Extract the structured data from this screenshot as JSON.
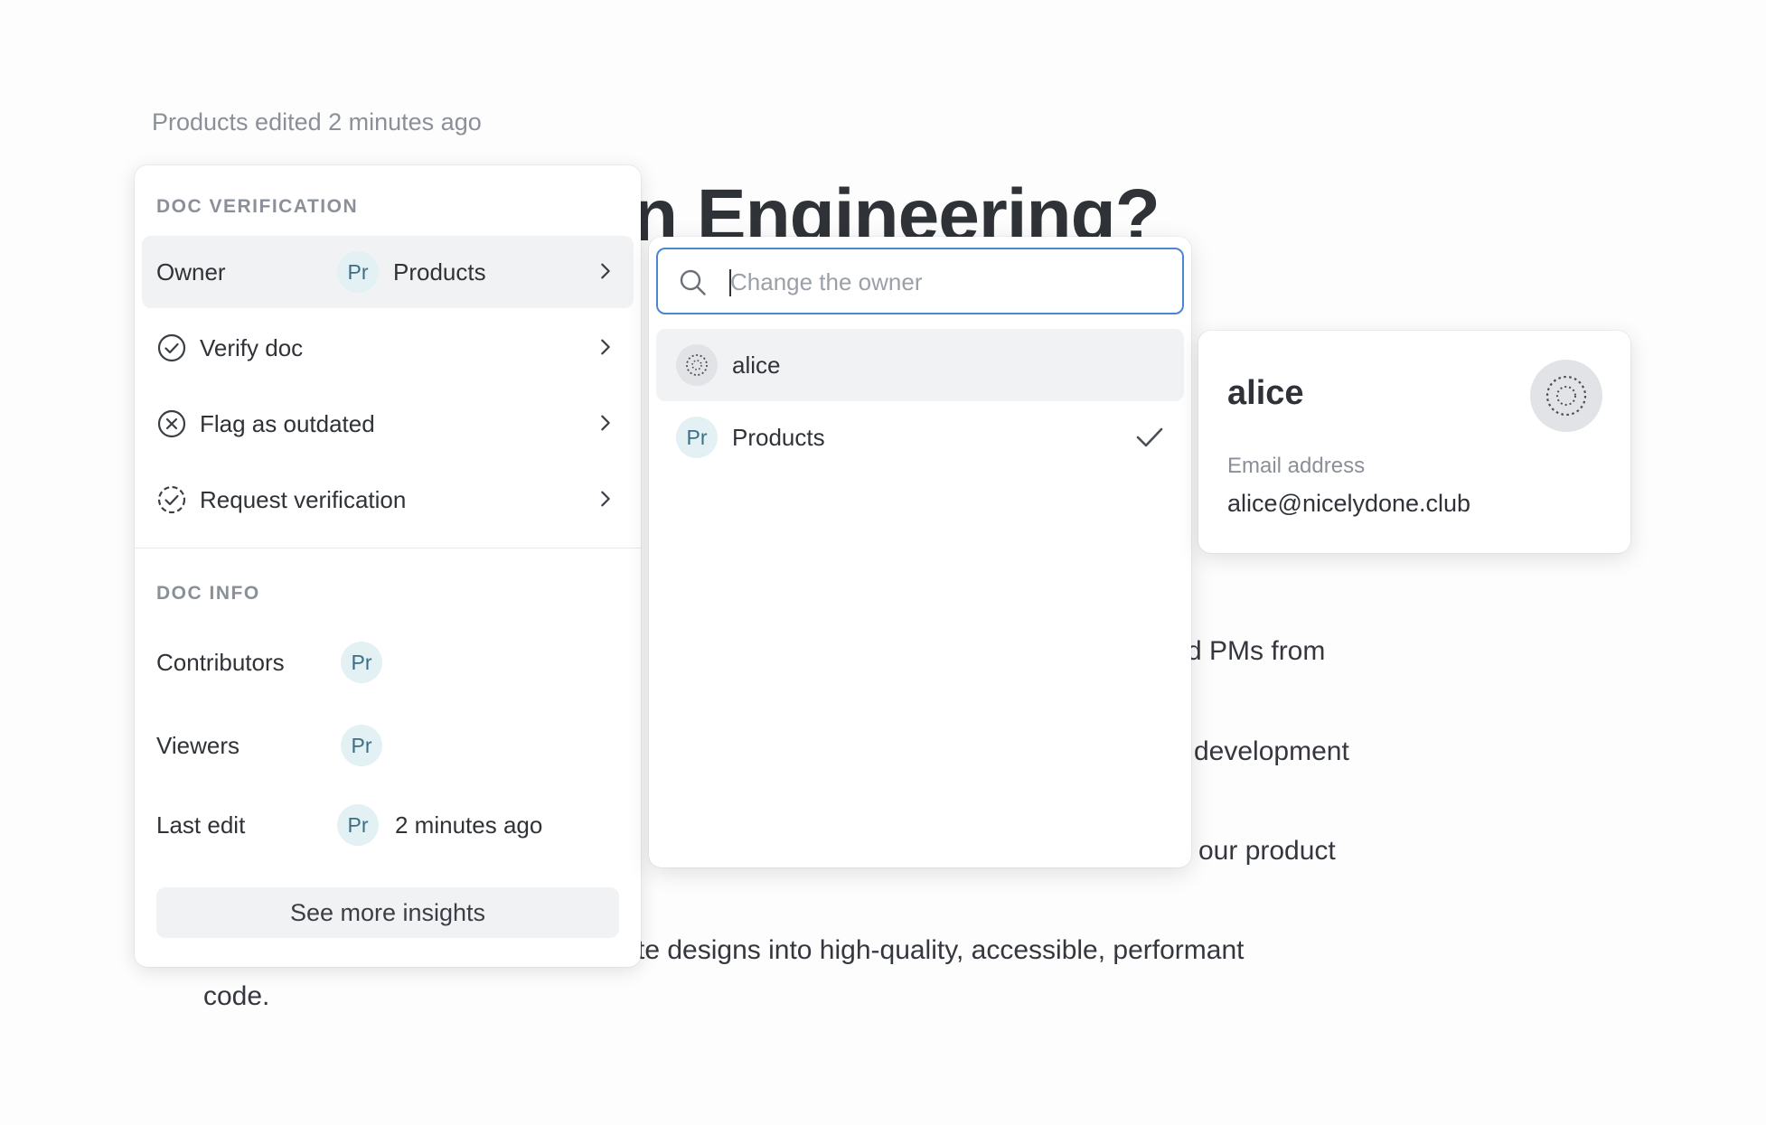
{
  "doc": {
    "edited_note": "Products edited 2 minutes ago",
    "title_fragment": "n Engineering?",
    "body_lines": {
      "l1": "d PMs from",
      "l2": "development",
      "l3": "our product",
      "l4": "te designs into high-quality, accessible, performant",
      "l5": "code."
    }
  },
  "doc_verification": {
    "section_title": "DOC VERIFICATION",
    "owner": {
      "label": "Owner",
      "avatar": "Pr",
      "value": "Products",
      "icon": "chevron-right-icon"
    },
    "items": [
      {
        "label": "Verify doc",
        "icon": "check-circle-icon"
      },
      {
        "label": "Flag as outdated",
        "icon": "x-circle-icon"
      },
      {
        "label": "Request verification",
        "icon": "dashed-check-circle-icon"
      }
    ]
  },
  "doc_info": {
    "section_title": "DOC INFO",
    "contributors": {
      "label": "Contributors",
      "avatar": "Pr"
    },
    "viewers": {
      "label": "Viewers",
      "avatar": "Pr"
    },
    "last_edit": {
      "label": "Last edit",
      "avatar": "Pr",
      "value": "2 minutes ago"
    },
    "insights_button": "See more insights"
  },
  "owner_picker": {
    "search_placeholder": "Change the owner",
    "search_value": "",
    "options": [
      {
        "label": "alice",
        "avatar": "dotted-avatar-icon",
        "selected": false
      },
      {
        "label": "Products",
        "avatar": "Pr",
        "selected": true
      }
    ]
  },
  "user_card": {
    "name": "alice",
    "email_label": "Email address",
    "email": "alice@nicelydone.club"
  },
  "colors": {
    "accent": "#4a86d4",
    "avatar_bg": "#e3f0f4",
    "avatar_text": "#3c6f86",
    "muted_text": "#8a8f98"
  }
}
